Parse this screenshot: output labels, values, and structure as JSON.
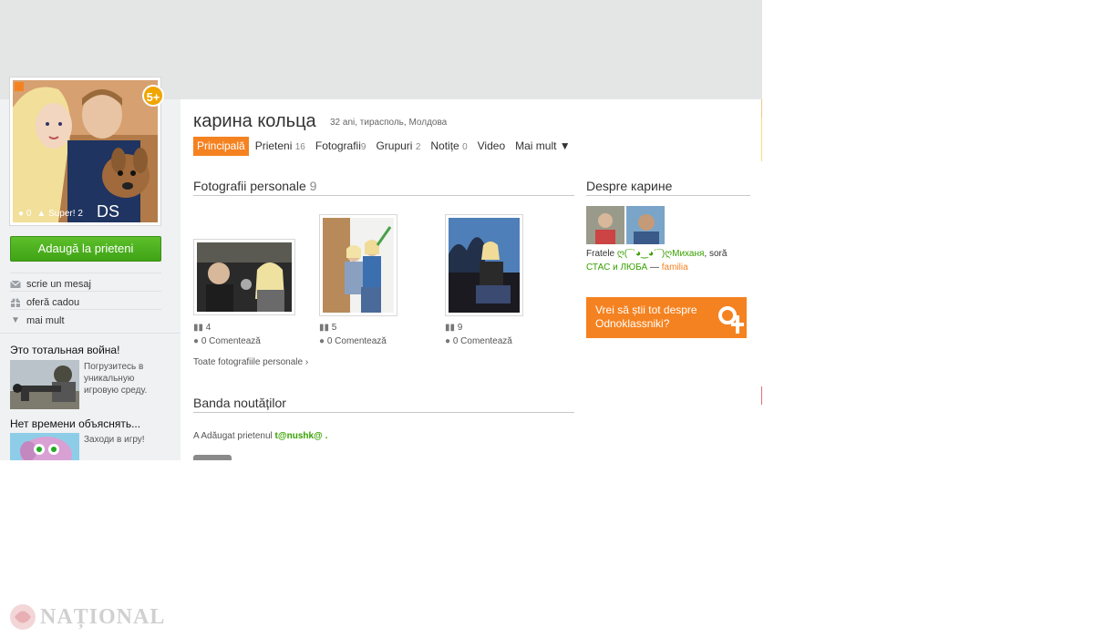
{
  "profile": {
    "name": "карина кольца",
    "meta": "32 ani, тирасполь, Молдова",
    "badge": "5+",
    "avatar_comments": "0",
    "avatar_likes": "Super! 2"
  },
  "tabs": [
    {
      "label": "Principală",
      "count": ""
    },
    {
      "label": "Prieteni",
      "count": "16"
    },
    {
      "label": "Fotografii",
      "count": "9"
    },
    {
      "label": "Grupuri",
      "count": "2"
    },
    {
      "label": "Notițe",
      "count": "0"
    },
    {
      "label": "Video",
      "count": ""
    },
    {
      "label": "Mai mult ▼",
      "count": ""
    }
  ],
  "sidebar": {
    "add_friend_label": "Adaugă la prieteni",
    "actions": [
      {
        "label": "scrie un mesaj",
        "icon": "envelope-icon"
      },
      {
        "label": "oferă cadou",
        "icon": "gift-icon"
      },
      {
        "label": "mai mult",
        "icon": "triangle-down-icon"
      }
    ],
    "ads": [
      {
        "title": "Это тотальная война!",
        "text": "Погрузитесь в уникальную игровую среду."
      },
      {
        "title": "Нет времени объяснять...",
        "text": "Заходи в игру!"
      }
    ]
  },
  "photos_section": {
    "title": "Fotografii personale",
    "count": "9",
    "photos": [
      {
        "views": "4",
        "comments": "0 Comentează"
      },
      {
        "views": "5",
        "comments": "0 Comentează"
      },
      {
        "views": "9",
        "comments": "0 Comentează"
      }
    ],
    "all_link": "Toate fotografiile personale ›"
  },
  "news_section": {
    "title": "Banda noutăților",
    "entry_prefix": "A Adăugat prietenul",
    "entry_friend": "t@nushk@ .",
    "entry_suffix": ""
  },
  "about": {
    "title": "Despre карине",
    "line1_prefix": "Fratele",
    "line1_link": "ღ(¯`◕‿◕´¯)ღМиханя",
    "line1_suffix": ", soră",
    "line2_link1": "СТАС и ЛЮБА",
    "line2_dash": "—",
    "line2_link2": "familia"
  },
  "promo": {
    "text": "Vrei să știi tot despre Odnoklassniki?"
  },
  "footer": {
    "logo_text": "NAȚIONAL"
  },
  "colors": {
    "accent": "#f58220",
    "green": "#3fa316",
    "topbar": "#e4e6e6"
  }
}
